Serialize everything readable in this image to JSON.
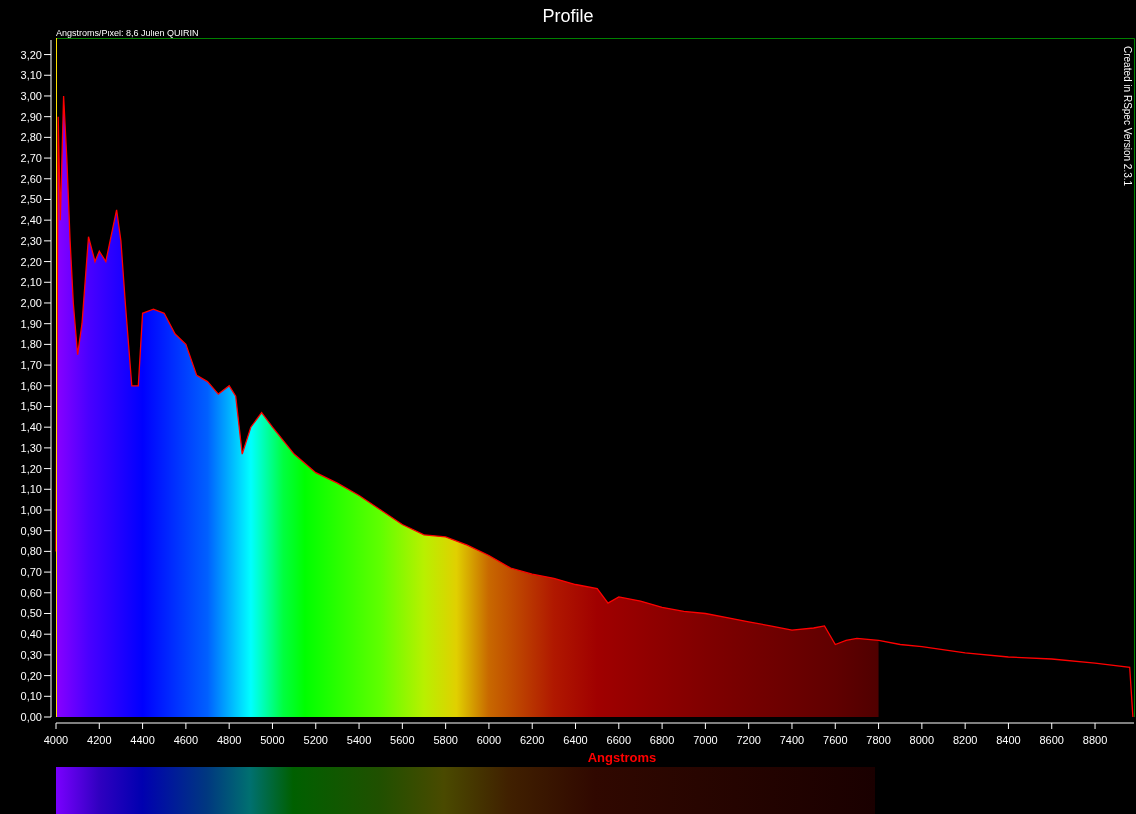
{
  "window": {
    "title": "Profile"
  },
  "header_note": "Angstroms/Pixel: 8,6 Julien QUIRIN",
  "credit": "Created in RSpec Version 2.3.1",
  "chart_data": {
    "type": "area",
    "xlabel": "Angstroms",
    "x": [
      4000,
      4010,
      4020,
      4035,
      4050,
      4065,
      4080,
      4100,
      4120,
      4150,
      4180,
      4200,
      4230,
      4250,
      4280,
      4300,
      4320,
      4350,
      4380,
      4400,
      4450,
      4500,
      4550,
      4600,
      4650,
      4700,
      4750,
      4800,
      4830,
      4860,
      4900,
      4950,
      5000,
      5100,
      5200,
      5300,
      5400,
      5500,
      5600,
      5700,
      5800,
      5900,
      6000,
      6100,
      6200,
      6300,
      6400,
      6500,
      6550,
      6600,
      6700,
      6800,
      6900,
      7000,
      7100,
      7200,
      7300,
      7400,
      7500,
      7550,
      7600,
      7650,
      7700,
      7800,
      7900,
      8000,
      8200,
      8400,
      8600,
      8800,
      8960,
      8975
    ],
    "series": [
      {
        "color": "#ff0000",
        "values": [
          0.8,
          2.9,
          2.4,
          3.0,
          2.7,
          2.3,
          2.0,
          1.75,
          1.9,
          2.32,
          2.2,
          2.25,
          2.2,
          2.3,
          2.45,
          2.3,
          2.0,
          1.6,
          1.6,
          1.95,
          1.97,
          1.95,
          1.85,
          1.8,
          1.65,
          1.62,
          1.56,
          1.6,
          1.55,
          1.27,
          1.4,
          1.47,
          1.4,
          1.27,
          1.18,
          1.13,
          1.07,
          1.0,
          0.93,
          0.88,
          0.87,
          0.83,
          0.78,
          0.72,
          0.69,
          0.67,
          0.64,
          0.62,
          0.55,
          0.58,
          0.56,
          0.53,
          0.51,
          0.5,
          0.48,
          0.46,
          0.44,
          0.42,
          0.43,
          0.44,
          0.35,
          0.37,
          0.38,
          0.37,
          0.35,
          0.34,
          0.31,
          0.29,
          0.28,
          0.26,
          0.24,
          0.0
        ]
      }
    ],
    "xlim": [
      4000,
      8980
    ],
    "ylim": [
      0,
      3.28
    ],
    "xticks": [
      4000,
      4200,
      4400,
      4600,
      4800,
      5000,
      5200,
      5400,
      5600,
      5800,
      6000,
      6200,
      6400,
      6600,
      6800,
      7000,
      7200,
      7400,
      7600,
      7800,
      8000,
      8200,
      8400,
      8600,
      8800
    ],
    "yticks": [
      {
        "value": 0,
        "label": "0,00"
      },
      {
        "value": 0.1,
        "label": "0,10"
      },
      {
        "value": 0.2,
        "label": "0,20"
      },
      {
        "value": 0.3,
        "label": "0,30"
      },
      {
        "value": 0.4,
        "label": "0,40"
      },
      {
        "value": 0.5,
        "label": "0,50"
      },
      {
        "value": 0.6,
        "label": "0,60"
      },
      {
        "value": 0.7,
        "label": "0,70"
      },
      {
        "value": 0.8,
        "label": "0,80"
      },
      {
        "value": 0.9,
        "label": "0,90"
      },
      {
        "value": 1.0,
        "label": "1,00"
      },
      {
        "value": 1.1,
        "label": "1,10"
      },
      {
        "value": 1.2,
        "label": "1,20"
      },
      {
        "value": 1.3,
        "label": "1,30"
      },
      {
        "value": 1.4,
        "label": "1,40"
      },
      {
        "value": 1.5,
        "label": "1,50"
      },
      {
        "value": 1.6,
        "label": "1,60"
      },
      {
        "value": 1.7,
        "label": "1,70"
      },
      {
        "value": 1.8,
        "label": "1,80"
      },
      {
        "value": 1.9,
        "label": "1,90"
      },
      {
        "value": 2.0,
        "label": "2,00"
      },
      {
        "value": 2.1,
        "label": "2,10"
      },
      {
        "value": 2.2,
        "label": "2,20"
      },
      {
        "value": 2.3,
        "label": "2,30"
      },
      {
        "value": 2.4,
        "label": "2,40"
      },
      {
        "value": 2.5,
        "label": "2,50"
      },
      {
        "value": 2.6,
        "label": "2,60"
      },
      {
        "value": 2.7,
        "label": "2,70"
      },
      {
        "value": 2.8,
        "label": "2,80"
      },
      {
        "value": 2.9,
        "label": "2,90"
      },
      {
        "value": 3.0,
        "label": "3,00"
      },
      {
        "value": 3.1,
        "label": "3,10"
      },
      {
        "value": 3.2,
        "label": "3,20"
      }
    ]
  }
}
